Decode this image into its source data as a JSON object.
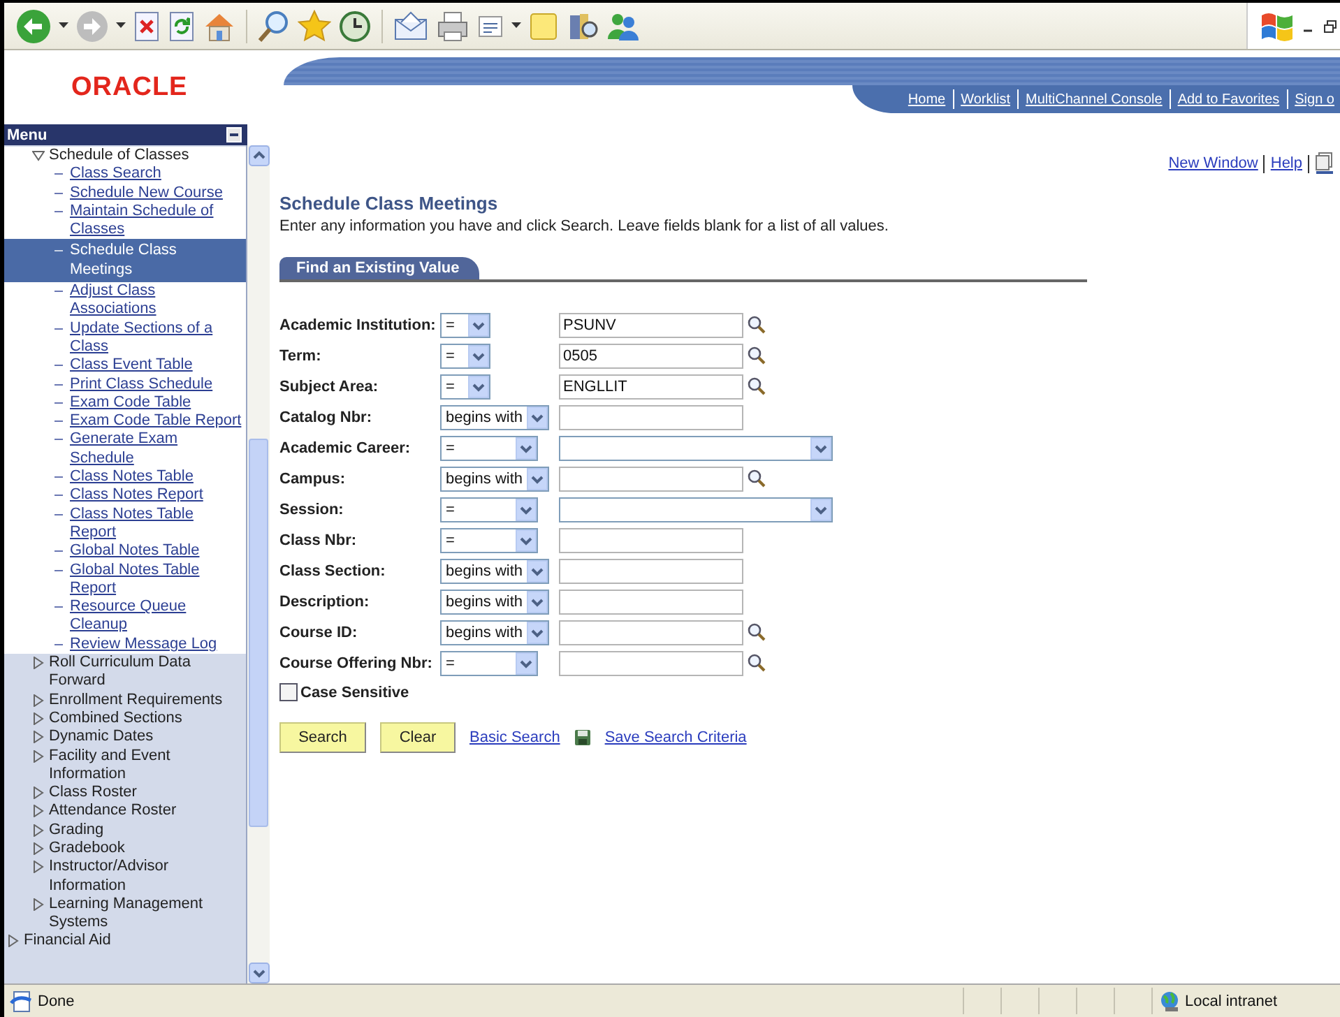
{
  "header": {
    "logo": "ORACLE",
    "nav": [
      "Home",
      "Worklist",
      "MultiChannel Console",
      "Add to Favorites",
      "Sign o"
    ]
  },
  "menu": {
    "title": "Menu",
    "groups": [
      {
        "label": "Schedule of Classes",
        "expanded": true,
        "children": [
          {
            "label": "Class Search",
            "selected": false
          },
          {
            "label": "Schedule New Course",
            "selected": false
          },
          {
            "label": "Maintain Schedule of Classes",
            "selected": false
          },
          {
            "label": "Schedule Class Meetings",
            "selected": true
          },
          {
            "label": "Adjust Class Associations",
            "selected": false
          },
          {
            "label": "Update Sections of a Class",
            "selected": false
          },
          {
            "label": "Class Event Table",
            "selected": false
          },
          {
            "label": "Print Class Schedule",
            "selected": false
          },
          {
            "label": "Exam Code Table",
            "selected": false
          },
          {
            "label": "Exam Code Table Report",
            "selected": false
          },
          {
            "label": "Generate Exam Schedule",
            "selected": false
          },
          {
            "label": "Class Notes Table",
            "selected": false
          },
          {
            "label": "Class Notes Report",
            "selected": false
          },
          {
            "label": "Class Notes Table Report",
            "selected": false
          },
          {
            "label": "Global Notes Table",
            "selected": false
          },
          {
            "label": "Global Notes Table Report",
            "selected": false
          },
          {
            "label": "Resource Queue Cleanup",
            "selected": false
          },
          {
            "label": "Review Message Log",
            "selected": false
          }
        ]
      },
      {
        "label": "Roll Curriculum Data Forward",
        "expanded": false
      },
      {
        "label": "Enrollment Requirements",
        "expanded": false
      },
      {
        "label": "Combined Sections",
        "expanded": false
      },
      {
        "label": "Dynamic Dates",
        "expanded": false
      },
      {
        "label": "Facility and Event Information",
        "expanded": false
      },
      {
        "label": "Class Roster",
        "expanded": false
      },
      {
        "label": "Attendance Roster",
        "expanded": false
      },
      {
        "label": "Grading",
        "expanded": false
      },
      {
        "label": "Gradebook",
        "expanded": false
      },
      {
        "label": "Instructor/Advisor Information",
        "expanded": false
      },
      {
        "label": "Learning Management Systems",
        "expanded": false
      }
    ],
    "outer_items": [
      {
        "label": "Financial Aid",
        "expanded": false
      }
    ]
  },
  "page_links": [
    "New Window",
    "Help"
  ],
  "title": "Schedule Class Meetings",
  "instructions": "Enter any information you have and click Search. Leave fields blank for a list of all values.",
  "tabs": [
    {
      "label": "Find an Existing Value",
      "selected": true
    }
  ],
  "fields": [
    {
      "label": "Academic Institution:",
      "kind": "key",
      "operator": "=",
      "value": "PSUNV",
      "lookup": true
    },
    {
      "label": "Term:",
      "kind": "key",
      "operator": "=",
      "value": "0505",
      "lookup": true
    },
    {
      "label": "Subject Area:",
      "kind": "key",
      "operator": "=",
      "value": "ENGLLIT",
      "lookup": true
    },
    {
      "label": "Catalog Nbr:",
      "kind": "text",
      "operator": "begins with",
      "lookup": false
    },
    {
      "label": "Academic Career:",
      "kind": "dropdown",
      "operator": "=",
      "lookup": false
    },
    {
      "label": "Campus:",
      "kind": "text",
      "operator": "begins with",
      "lookup": true
    },
    {
      "label": "Session:",
      "kind": "dropdown",
      "operator": "=",
      "lookup": false
    },
    {
      "label": "Class Nbr:",
      "kind": "text",
      "operator": "=",
      "lookup": false
    },
    {
      "label": "Class Section:",
      "kind": "text",
      "operator": "begins with",
      "lookup": false
    },
    {
      "label": "Description:",
      "kind": "text",
      "operator": "begins with",
      "lookup": false
    },
    {
      "label": "Course ID:",
      "kind": "text",
      "operator": "begins with",
      "lookup": true
    },
    {
      "label": "Course Offering Nbr:",
      "kind": "text",
      "operator": "=",
      "lookup": true
    }
  ],
  "case_sensitive": {
    "label": "Case Sensitive",
    "checked": false
  },
  "buttons": [
    "Search",
    "Clear"
  ],
  "links": [
    "Basic Search",
    "Save Search Criteria"
  ],
  "status_bar": {
    "text": "Done",
    "zone": "Local intranet"
  }
}
